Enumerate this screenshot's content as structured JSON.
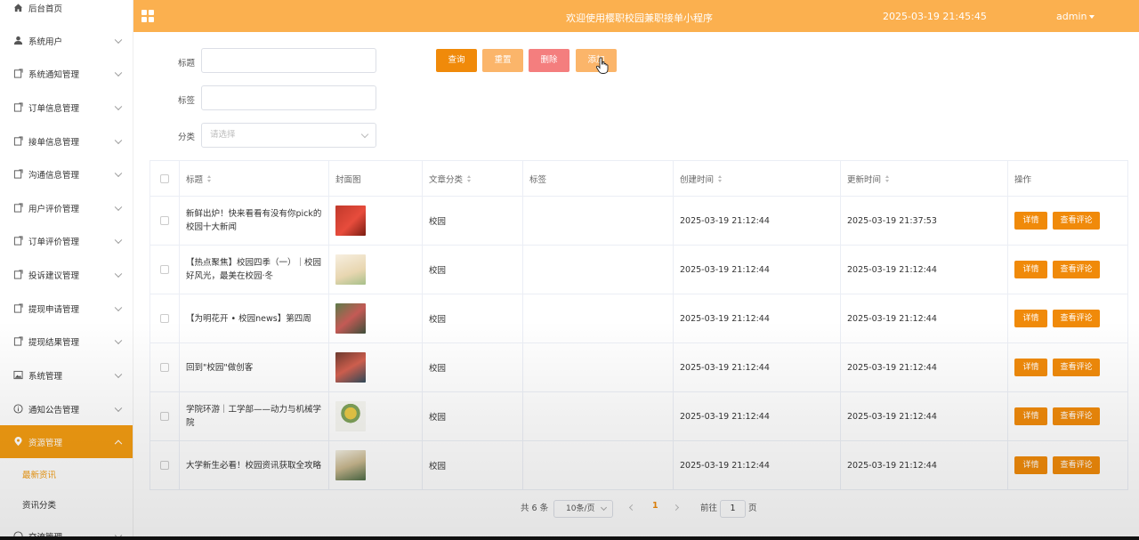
{
  "colors": {
    "accent": "#f39c12",
    "topbar": "#fbb04f",
    "query_button": "#f08a0a",
    "reset_button": "#fbb56a",
    "delete_button": "#f47e7e",
    "add_button": "#fbb56a"
  },
  "sidebar": {
    "items": [
      {
        "label": "后台首页",
        "icon": "home-icon"
      },
      {
        "label": "系统用户",
        "icon": "user-icon"
      },
      {
        "label": "系统通知管理",
        "icon": "notice-icon"
      },
      {
        "label": "订单信息管理",
        "icon": "order-icon"
      },
      {
        "label": "接单信息管理",
        "icon": "take-order-icon"
      },
      {
        "label": "沟通信息管理",
        "icon": "chat-icon"
      },
      {
        "label": "用户评价管理",
        "icon": "review-icon"
      },
      {
        "label": "订单评价管理",
        "icon": "order-review-icon"
      },
      {
        "label": "投诉建议管理",
        "icon": "complaint-icon"
      },
      {
        "label": "提现申请管理",
        "icon": "withdraw-icon"
      },
      {
        "label": "提现结果管理",
        "icon": "withdraw-result-icon"
      },
      {
        "label": "系统管理",
        "icon": "image-icon"
      },
      {
        "label": "通知公告管理",
        "icon": "info-icon"
      },
      {
        "label": "资源管理",
        "icon": "location-pin-icon"
      },
      {
        "label": "交流管理",
        "icon": "exchange-icon"
      }
    ],
    "sub_items": [
      {
        "label": "最新资讯"
      },
      {
        "label": "资讯分类"
      }
    ]
  },
  "header": {
    "title": "欢迎使用樱职校园兼职接单小程序",
    "datetime": "2025-03-19 21:45:45",
    "user": "admin"
  },
  "filters": {
    "title_label": "标题",
    "tag_label": "标签",
    "category_label": "分类",
    "category_placeholder": "请选择"
  },
  "buttons": {
    "query": "查询",
    "reset": "重置",
    "delete": "删除",
    "add": "添加"
  },
  "table": {
    "columns": [
      "标题",
      "封面图",
      "文章分类",
      "标签",
      "创建时间",
      "更新时间",
      "操作"
    ],
    "rows": [
      {
        "title": "新鲜出炉！快来看看有没有你pick的校园十大新闻",
        "category": "校园",
        "tag": "",
        "created": "2025-03-19 21:12:44",
        "updated": "2025-03-19 21:37:53"
      },
      {
        "title": "【热点聚焦】校园四季（一）｜校园好风光，最美在校园·冬",
        "category": "校园",
        "tag": "",
        "created": "2025-03-19 21:12:44",
        "updated": "2025-03-19 21:12:44"
      },
      {
        "title": "【为明花开 • 校园news】第四周",
        "category": "校园",
        "tag": "",
        "created": "2025-03-19 21:12:44",
        "updated": "2025-03-19 21:12:44"
      },
      {
        "title": "回到\"校园\"做创客",
        "category": "校园",
        "tag": "",
        "created": "2025-03-19 21:12:44",
        "updated": "2025-03-19 21:12:44"
      },
      {
        "title": "学院环游｜工学部——动力与机械学院",
        "category": "校园",
        "tag": "",
        "created": "2025-03-19 21:12:44",
        "updated": "2025-03-19 21:12:44"
      },
      {
        "title": "大学新生必看！校园资讯获取全攻略",
        "category": "校园",
        "tag": "",
        "created": "2025-03-19 21:12:44",
        "updated": "2025-03-19 21:12:44"
      }
    ],
    "detail_label": "详情",
    "comments_label": "查看评论"
  },
  "pagination": {
    "total_text": "共 6 条",
    "page_size": "10条/页",
    "current_page": "1",
    "goto_prefix": "前往",
    "goto_value": "1",
    "goto_suffix": "页"
  }
}
